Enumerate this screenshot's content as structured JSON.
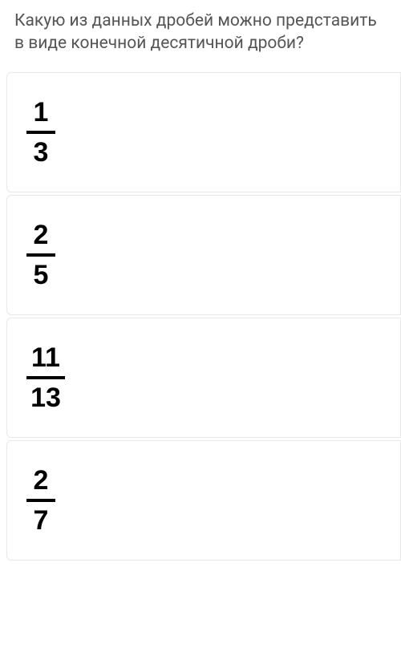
{
  "question": "Какую из данных дробей можно представить в виде конечной десятичной дроби?",
  "options": [
    {
      "numerator": "1",
      "denominator": "3"
    },
    {
      "numerator": "2",
      "denominator": "5"
    },
    {
      "numerator": "11",
      "denominator": "13"
    },
    {
      "numerator": "2",
      "denominator": "7"
    }
  ]
}
